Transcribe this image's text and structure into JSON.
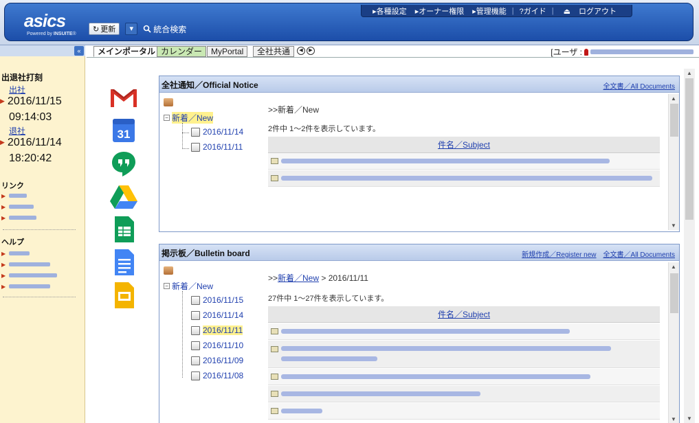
{
  "header": {
    "logo_text": "asics",
    "logo_powered": "Powered by",
    "logo_brand": "INSUITE",
    "refresh_label": "更新",
    "search_label": "統合検索",
    "nav": [
      "▸各種設定",
      "▸オーナー権限",
      "▸管理機能",
      "?ガイド",
      "ログアウト"
    ]
  },
  "sidebar": {
    "attendance_heading": "出退社打刻",
    "clock_in_label": "出社",
    "clock_in_date": "2016/11/15",
    "clock_in_time": "09:14:03",
    "clock_out_label": "退社",
    "clock_out_date": "2016/11/14",
    "clock_out_time": "18:20:42",
    "links_heading": "リンク",
    "help_heading": "ヘルプ"
  },
  "tabs": {
    "items": [
      "メインポータル",
      "カレンダー",
      "MyPortal",
      "全社共通"
    ],
    "user_label": "[ユーザ :"
  },
  "apps": [
    "gmail-icon",
    "google-calendar-icon",
    "hangouts-icon",
    "google-drive-icon",
    "google-sheets-icon",
    "google-docs-icon",
    "google-slides-icon"
  ],
  "calendar_icon_text": "31",
  "notice": {
    "title": "全社通知／Official Notice",
    "all_docs": "全文書／All Documents",
    "tree_root": "新着／New",
    "tree_dates": [
      "2016/11/14",
      "2016/11/11"
    ],
    "crumb": ">>新着／New",
    "count": "2件中 1～2件を表示しています。",
    "column": "件名／Subject"
  },
  "bulletin": {
    "title": "掲示板／Bulletin board",
    "register": "新規作成／Register new",
    "all_docs": "全文書／All Documents",
    "tree_root": "新着／New",
    "tree_dates": [
      "2016/11/15",
      "2016/11/14",
      "2016/11/11",
      "2016/11/10",
      "2016/11/09",
      "2016/11/08"
    ],
    "crumb_prefix": ">>",
    "crumb_link": "新着／New",
    "crumb_suffix": " > 2016/11/11",
    "count": "27件中 1～27件を表示しています。",
    "column": "件名／Subject"
  },
  "colors": {
    "accent": "#1c4ea9",
    "sidebar_bg": "#fdf3cf",
    "highlight": "#fff18e"
  }
}
